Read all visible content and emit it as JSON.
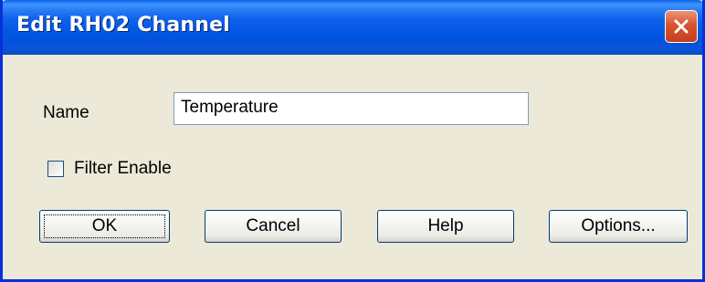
{
  "window": {
    "title": "Edit RH02 Channel"
  },
  "form": {
    "name_label": "Name",
    "name_value": "Temperature",
    "filter_label": "Filter Enable",
    "filter_checked": false
  },
  "buttons": {
    "ok": "OK",
    "cancel": "Cancel",
    "help": "Help",
    "options": "Options..."
  },
  "icons": {
    "close": "close-icon"
  },
  "colors": {
    "title_bar": "#0458e3",
    "close_button": "#d8532f",
    "dialog_background": "#ece9d8"
  }
}
